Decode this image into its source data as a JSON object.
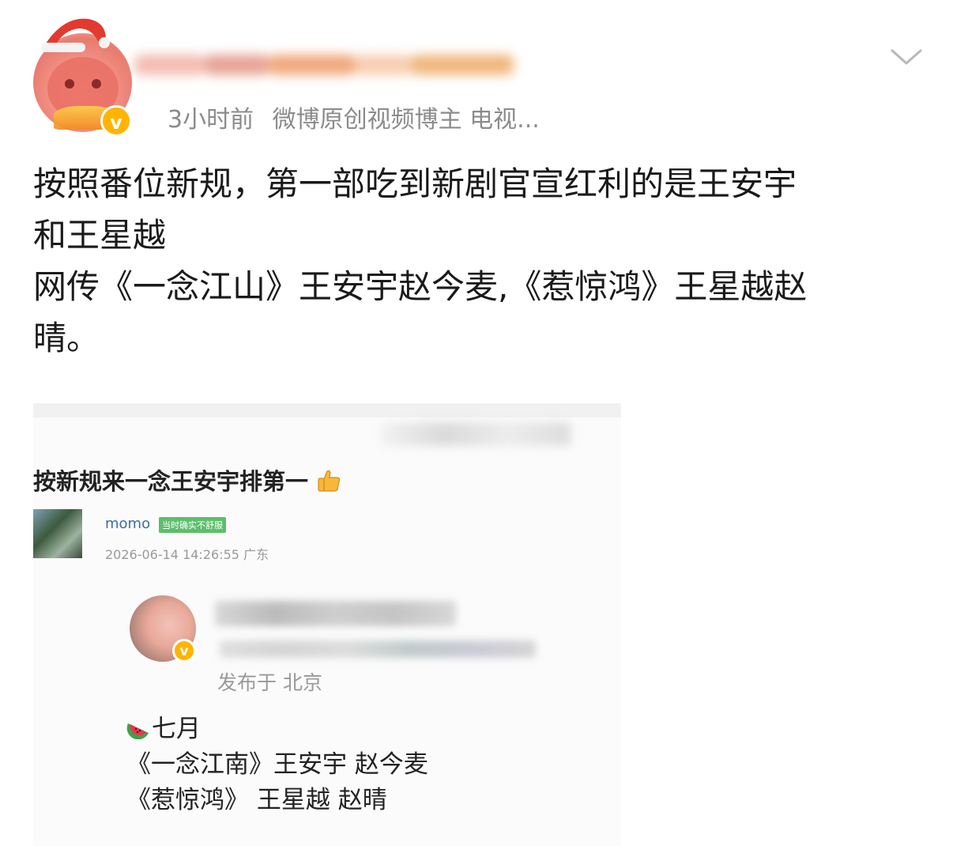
{
  "post": {
    "author_name_blurred": "██████",
    "time": "3小时前",
    "author_title": "微博原创视频博主 电视...",
    "verified_badge": "v",
    "text_lines": [
      "按照番位新规，第一部吃到新剧官宣红利的是王安宇",
      "和王星越",
      "网传《一念江山》王安宇赵今麦,《惹惊鸿》王星越赵",
      "晴。"
    ]
  },
  "screenshot": {
    "title": "按新规来一念王安宇排第一",
    "comment": {
      "username": "momo",
      "tag": "当时确实不舒服",
      "timestamp": "2026-06-14 14:26:55 广东"
    },
    "quoted": {
      "verified_badge": "v",
      "location": "发布于 北京",
      "lines": [
        "七月",
        "《一念江南》王安宇 赵今麦",
        "《惹惊鸿》 王星越 赵晴"
      ]
    }
  },
  "colors": {
    "meta_gray": "#8b8b8b",
    "verified": "#ffb400",
    "link_blue": "#3a6ea5",
    "tag_green": "#5cbf6b"
  },
  "icons": [
    "santa-hat-icon",
    "verified-icon",
    "chevron-down-icon",
    "thumbs-up-icon",
    "watermelon-icon"
  ]
}
